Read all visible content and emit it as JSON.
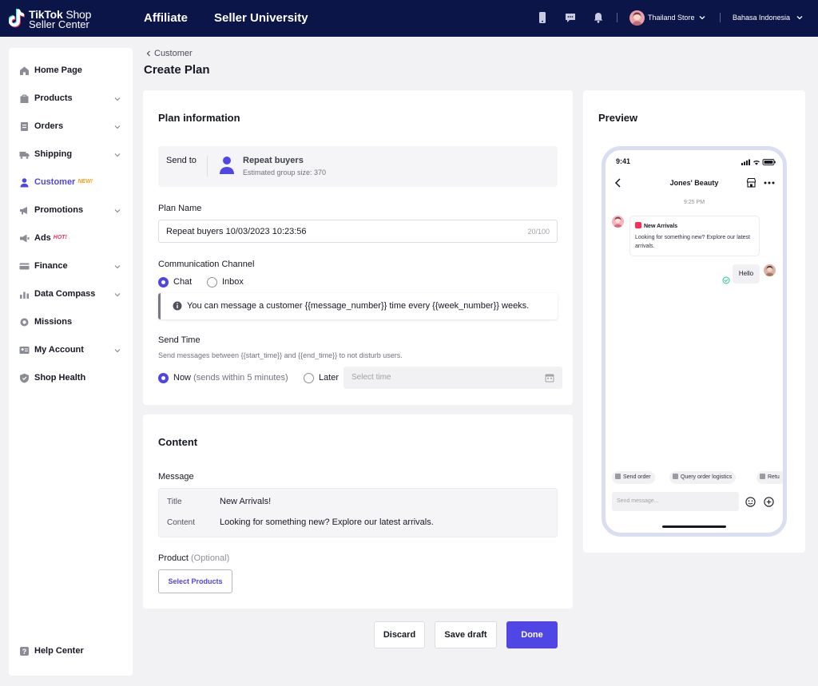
{
  "header": {
    "logo_line1_bold": "TikTok",
    "logo_line1_thin": " Shop",
    "logo_line2": "Seller Center",
    "nav": [
      "Affiliate",
      "Seller University"
    ],
    "store_name": "Thailand Store",
    "language": "Bahasa Indonesia"
  },
  "sidebar": {
    "items": [
      {
        "label": "Home Page",
        "icon": "home-icon",
        "expandable": false
      },
      {
        "label": "Products",
        "icon": "products-icon",
        "expandable": true
      },
      {
        "label": "Orders",
        "icon": "orders-icon",
        "expandable": true
      },
      {
        "label": "Shipping",
        "icon": "truck-icon",
        "expandable": true
      },
      {
        "label": "Customer",
        "icon": "user-icon",
        "expandable": false,
        "active": true,
        "tag": "NEW!"
      },
      {
        "label": "Promotions",
        "icon": "megaphone-icon",
        "expandable": true
      },
      {
        "label": "Ads",
        "icon": "ads-icon",
        "expandable": false,
        "tag": "HOT!"
      },
      {
        "label": "Finance",
        "icon": "card-icon",
        "expandable": true
      },
      {
        "label": "Data Compass",
        "icon": "chart-icon",
        "expandable": true
      },
      {
        "label": "Missions",
        "icon": "medal-icon",
        "expandable": false
      },
      {
        "label": "My Account",
        "icon": "account-icon",
        "expandable": true
      },
      {
        "label": "Shop Health",
        "icon": "shield-icon",
        "expandable": false
      }
    ],
    "help_center": "Help Center"
  },
  "page": {
    "breadcrumb": "Customer",
    "title": "Create Plan"
  },
  "plan_info": {
    "section_title": "Plan information",
    "send_to_label": "Send to",
    "audience_name": "Repeat buyers",
    "audience_size": "Estimated group size: 370",
    "plan_name_label": "Plan Name",
    "plan_name_value": "Repeat buyers 10/03/2023 10:23:56",
    "plan_name_count": "20/100",
    "channel_label": "Communication Channel",
    "channel_options": [
      "Chat",
      "Inbox"
    ],
    "channel_selected": "Chat",
    "info_text": "You can message a customer {{message_number}} time every  {{week_number}} weeks.",
    "send_time_label": "Send Time",
    "send_time_helper": "Send messages between {{start_time}} and {{end_time}} to not disturb users.",
    "now_label": "Now",
    "now_sub": " (sends within 5 minutes)",
    "later_label": "Later",
    "time_placeholder": "Select time",
    "send_time_selected": "Now"
  },
  "content": {
    "section_title": "Content",
    "message_label": "Message",
    "title_key": "Title",
    "title_value": "New Arrivals!",
    "content_key": "Content",
    "content_value": "Looking for something new? Explore our latest arrivals.",
    "product_label": "Product",
    "product_optional": " (Optional)",
    "select_products": "Select Products"
  },
  "actions": {
    "discard": "Discard",
    "save_draft": "Save draft",
    "done": "Done"
  },
  "preview": {
    "title": "Preview",
    "status_time": "9:41",
    "chat_title": "Jones' Beauty",
    "timestamp": "9:25 PM",
    "incoming_title": "New Arrivals",
    "incoming_body": "Looking for something new? Explore our latest arrivals.",
    "outgoing": "Hello",
    "chips": [
      "Send order",
      "Query order logistics",
      "Retu"
    ],
    "input_placeholder": "Send message..."
  },
  "colors": {
    "topbar": "#0b1547",
    "accent": "#4f46e5",
    "tag_new": "#f59f16",
    "tag_hot": "#fe2c55"
  }
}
